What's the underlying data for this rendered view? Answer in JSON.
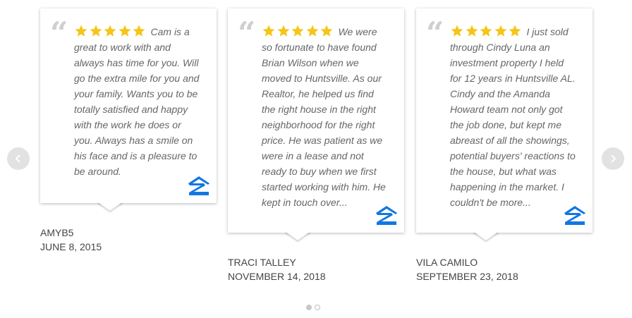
{
  "colors": {
    "star": "#f5c518",
    "zillow": "#1277e1",
    "text": "#666666"
  },
  "nav": {
    "prev_icon": "chevron-left-icon",
    "next_icon": "chevron-right-icon"
  },
  "reviews": [
    {
      "rating": 5,
      "text": "Cam is a great to work with and always has time for you. Will go the extra mile for you and your family. Wants you to be totally satisfied and happy with the work he does or you. Always has a smile on his face and is a pleasure to be around.",
      "author": "AMYB5",
      "date": "JUNE 8, 2015"
    },
    {
      "rating": 5,
      "text": "We were so fortunate to have found Brian Wilson when we moved to Huntsville. As our Realtor, he helped us find the right house in the right neighborhood for the right price. He was patient as we were in a lease and not ready to buy when we first started working with him. He kept in touch over...",
      "author": "TRACI TALLEY",
      "date": "NOVEMBER 14, 2018"
    },
    {
      "rating": 5,
      "text": "I just sold through Cindy Luna an investment property I held for 12 years in Huntsville AL. Cindy and the Amanda Howard team not only got the job done, but kept me abreast of all the showings, potential buyers' reactions to the house, but what was happening in the market. I couldn't be more...",
      "author": "VILA CAMILO",
      "date": "SEPTEMBER 23, 2018"
    }
  ],
  "pagination": {
    "pages": 2,
    "current": 1
  }
}
